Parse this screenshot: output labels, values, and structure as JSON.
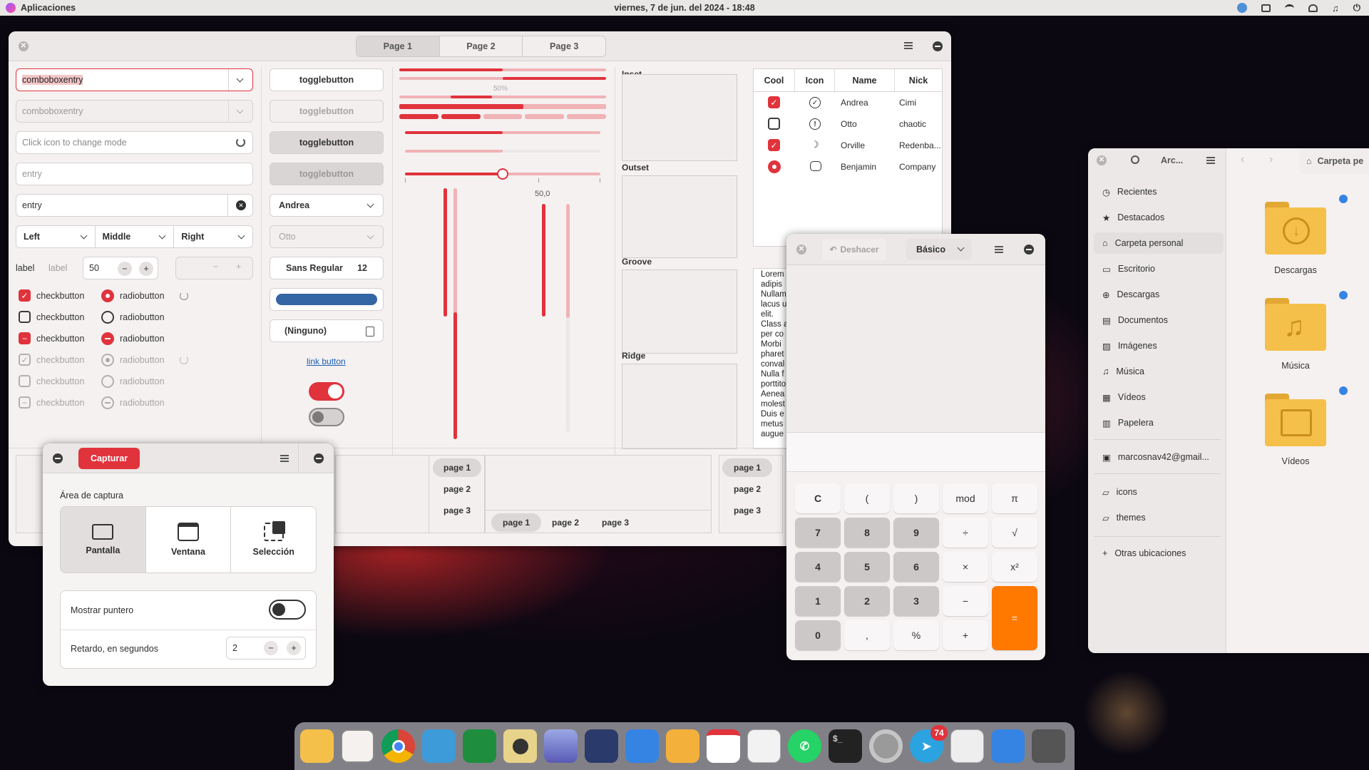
{
  "topbar": {
    "apps_label": "Aplicaciones",
    "clock": "viernes,  7 de jun. del 2024 - 18:48",
    "notify_badge": "74"
  },
  "widgets": {
    "tabs": [
      "Page 1",
      "Page 2",
      "Page 3"
    ],
    "combo1": "comboboxentry",
    "combo2": "comboboxentry",
    "entry_icon_placeholder": "Click icon to change mode",
    "entry_placeholder": "entry",
    "entry_value": "entry",
    "align": [
      "Left",
      "Middle",
      "Right"
    ],
    "label1": "label",
    "label2": "label",
    "spin_value": "50",
    "checkbutton": "checkbutton",
    "radiobutton": "radiobutton",
    "toggle": "togglebutton",
    "combo_name": "Andrea",
    "combo_name_dis": "Otto",
    "font_name": "Sans Regular",
    "font_size": "12",
    "file_none": "(Ninguno)",
    "link": "link button",
    "progress_label": "50%",
    "scale_value": "50,0",
    "progress_fill": 0.5,
    "frames": [
      "Inset",
      "Outset",
      "Groove",
      "Ridge"
    ],
    "tree": {
      "headers": [
        "Cool",
        "Icon",
        "Name",
        "Nick"
      ],
      "rows": [
        {
          "name": "Andrea",
          "nick": "Cimi"
        },
        {
          "name": "Otto",
          "nick": "chaotic"
        },
        {
          "name": "Orville",
          "nick": "Redenba..."
        },
        {
          "name": "Benjamin",
          "nick": "Company"
        }
      ]
    },
    "lorem": [
      "Lorem",
      "adipis",
      "Nullam",
      "lacus u",
      "elit.",
      "Class a",
      "per co",
      "Morbi",
      "pharet",
      "conval",
      "Nulla f",
      "porttito",
      "Aenea",
      "molest",
      "Duis e",
      "metus",
      "augue"
    ],
    "notebook_pages": [
      "page 1",
      "page 2",
      "page 3"
    ]
  },
  "capture": {
    "button": "Capturar",
    "area_label": "Área de captura",
    "options": [
      "Pantalla",
      "Ventana",
      "Selección"
    ],
    "pointer_label": "Mostrar puntero",
    "delay_label": "Retardo, en segundos",
    "delay_value": "2"
  },
  "calculator": {
    "undo": "Deshacer",
    "mode": "Básico",
    "keys": [
      [
        "C",
        "(",
        ")",
        "mod",
        "π"
      ],
      [
        "7",
        "8",
        "9",
        "÷",
        "√"
      ],
      [
        "4",
        "5",
        "6",
        "×",
        "x²"
      ],
      [
        "1",
        "2",
        "3",
        "−",
        "="
      ],
      [
        "0",
        ",",
        "%",
        "+",
        ""
      ]
    ]
  },
  "files": {
    "title": "Arc...",
    "path": "Carpeta pe",
    "sidebar": [
      "Recientes",
      "Destacados",
      "Carpeta personal",
      "Escritorio",
      "Descargas",
      "Documentos",
      "Imágenes",
      "Música",
      "Vídeos",
      "Papelera"
    ],
    "account": "marcosnav42@gmail...",
    "bookmarks": [
      "icons",
      "themes"
    ],
    "other": "Otras ubicaciones",
    "folders": [
      "Descargas",
      "Música",
      "Vídeos"
    ]
  },
  "colors": {
    "accent": "#e0333c",
    "equals": "#ff7800",
    "progress_blue": "#3465a4"
  }
}
